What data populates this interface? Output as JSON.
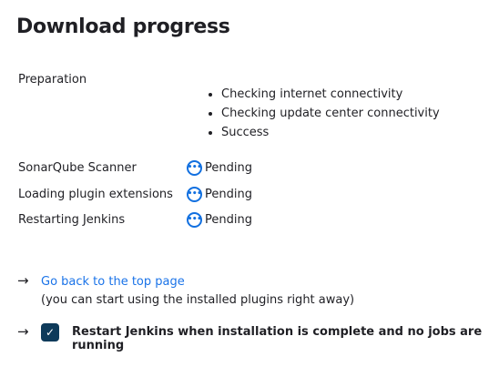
{
  "title": "Download progress",
  "preparation": {
    "label": "Preparation",
    "items": [
      "Checking internet connectivity",
      "Checking update center connectivity",
      "Success"
    ]
  },
  "tasks": [
    {
      "name": "SonarQube Scanner",
      "status": "Pending"
    },
    {
      "name": "Loading plugin extensions",
      "status": "Pending"
    },
    {
      "name": "Restarting Jenkins",
      "status": "Pending"
    }
  ],
  "links": {
    "top_page": "Go back to the top page",
    "top_page_note": "(you can start using the installed plugins right away)",
    "restart_label": "Restart Jenkins when installation is complete and no jobs are running",
    "restart_checked": true
  },
  "colors": {
    "link": "#1a73e8",
    "pending": "#1270e0",
    "checkbox": "#0e3a5a"
  }
}
